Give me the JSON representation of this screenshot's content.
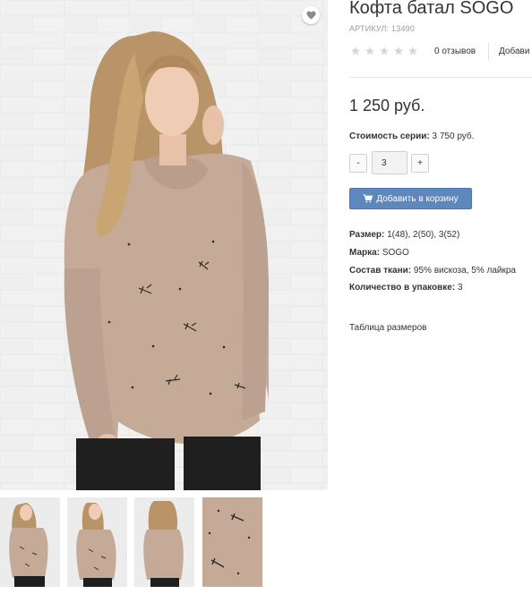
{
  "product": {
    "title": "Кофта батал SOGO",
    "sku": "АРТИКУЛ: 13490",
    "rating": {
      "filled": 0,
      "total": 5
    },
    "reviews": "0 отзывов",
    "add_review": "Добави",
    "price": "1 250 руб.",
    "series_label": "Стоимость серии:",
    "series_value": "3 750 руб."
  },
  "quantity": {
    "minus": "-",
    "value": "3",
    "plus": "+"
  },
  "cart": {
    "label": "Добавить в корзину",
    "icon": "cart-icon"
  },
  "specs": [
    {
      "label": "Размер:",
      "value": "1(48), 2(50), 3(52)"
    },
    {
      "label": "Марка:",
      "value": "SOGO"
    },
    {
      "label": "Состав ткани:",
      "value": "95% вискоза, 5% лайкра"
    },
    {
      "label": "Количество в упаковке:",
      "value": "3"
    }
  ],
  "size_table": "Таблица размеров",
  "favorite": {
    "icon": "heart-icon"
  },
  "colors": {
    "accent": "#5e87bd",
    "star": "#d6d6d6",
    "garment": "#c5aa98"
  }
}
